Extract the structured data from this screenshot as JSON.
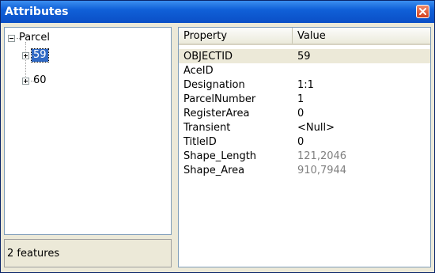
{
  "window": {
    "title": "Attributes"
  },
  "tree": {
    "root_label": "Parcel",
    "children": [
      {
        "label": "59",
        "selected": true
      },
      {
        "label": "60",
        "selected": false
      }
    ]
  },
  "status": {
    "text": "2 features"
  },
  "grid": {
    "headers": {
      "property": "Property",
      "value": "Value"
    },
    "rows": [
      {
        "property": "OBJECTID",
        "value": "59",
        "readonly": false
      },
      {
        "property": "AceID",
        "value": "",
        "readonly": false
      },
      {
        "property": "Designation",
        "value": "1:1",
        "readonly": false
      },
      {
        "property": "ParcelNumber",
        "value": "1",
        "readonly": false
      },
      {
        "property": "RegisterArea",
        "value": "0",
        "readonly": false
      },
      {
        "property": "Transient",
        "value": "<Null>",
        "readonly": false
      },
      {
        "property": "TitleID",
        "value": "0",
        "readonly": false
      },
      {
        "property": "Shape_Length",
        "value": "121,2046",
        "readonly": true
      },
      {
        "property": "Shape_Area",
        "value": "910,7944",
        "readonly": true
      }
    ]
  },
  "colors": {
    "title_bar": "#0a4fc6",
    "selection": "#316ac5",
    "close_button": "#d3401c"
  }
}
